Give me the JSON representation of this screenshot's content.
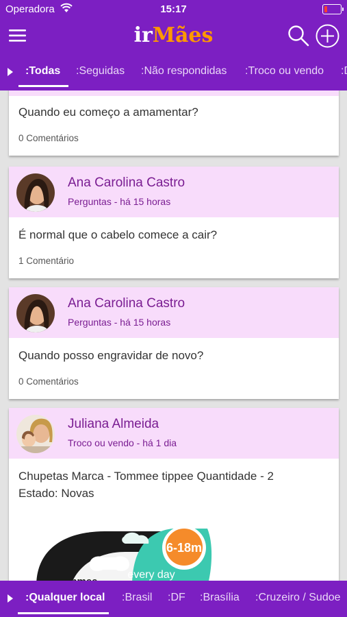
{
  "status_bar": {
    "carrier": "Operadora",
    "time": "15:17"
  },
  "app": {
    "logo_part1": "ir",
    "logo_part2": "Mães"
  },
  "filter_tabs": [
    {
      "label": ":Todas",
      "active": true
    },
    {
      "label": ":Seguidas",
      "active": false
    },
    {
      "label": ":Não respondidas",
      "active": false
    },
    {
      "label": ":Troco ou vendo",
      "active": false
    },
    {
      "label": ":D",
      "active": false
    }
  ],
  "posts": [
    {
      "question": "Quando eu começo a amamentar?",
      "comments": "0 Comentários"
    },
    {
      "author": "Ana Carolina Castro",
      "category_time": "Perguntas - há 15 horas",
      "question": "É normal que o cabelo comece a cair?",
      "comments": "1 Comentário"
    },
    {
      "author": "Ana Carolina Castro",
      "category_time": "Perguntas - há 15 horas",
      "question": "Quando posso engravidar de novo?",
      "comments": "0 Comentários"
    },
    {
      "author": "Juliana Almeida",
      "category_time": "Troco ou vendo - há 1 dia",
      "question_line1": "Chupetas Marca - Tommee tippee Quantidade - 2",
      "question_line2": "Estado: Novas",
      "image_badge": "6-18m",
      "image_text": "every day",
      "image_brand": "tommee"
    }
  ],
  "location_tabs": [
    {
      "label": ":Qualquer local",
      "active": true
    },
    {
      "label": ":Brasil",
      "active": false
    },
    {
      "label": ":DF",
      "active": false
    },
    {
      "label": ":Brasília",
      "active": false
    },
    {
      "label": ":Cruzeiro / Sudoe",
      "active": false
    }
  ],
  "colors": {
    "primary": "#7c1fc2",
    "card_header": "#f8dcfb",
    "author_text": "#7a1d92",
    "logo_accent": "#ff9800"
  },
  "icons": [
    "wifi-icon",
    "battery-icon",
    "menu-icon",
    "search-icon",
    "add-icon",
    "chevron-right-icon"
  ]
}
